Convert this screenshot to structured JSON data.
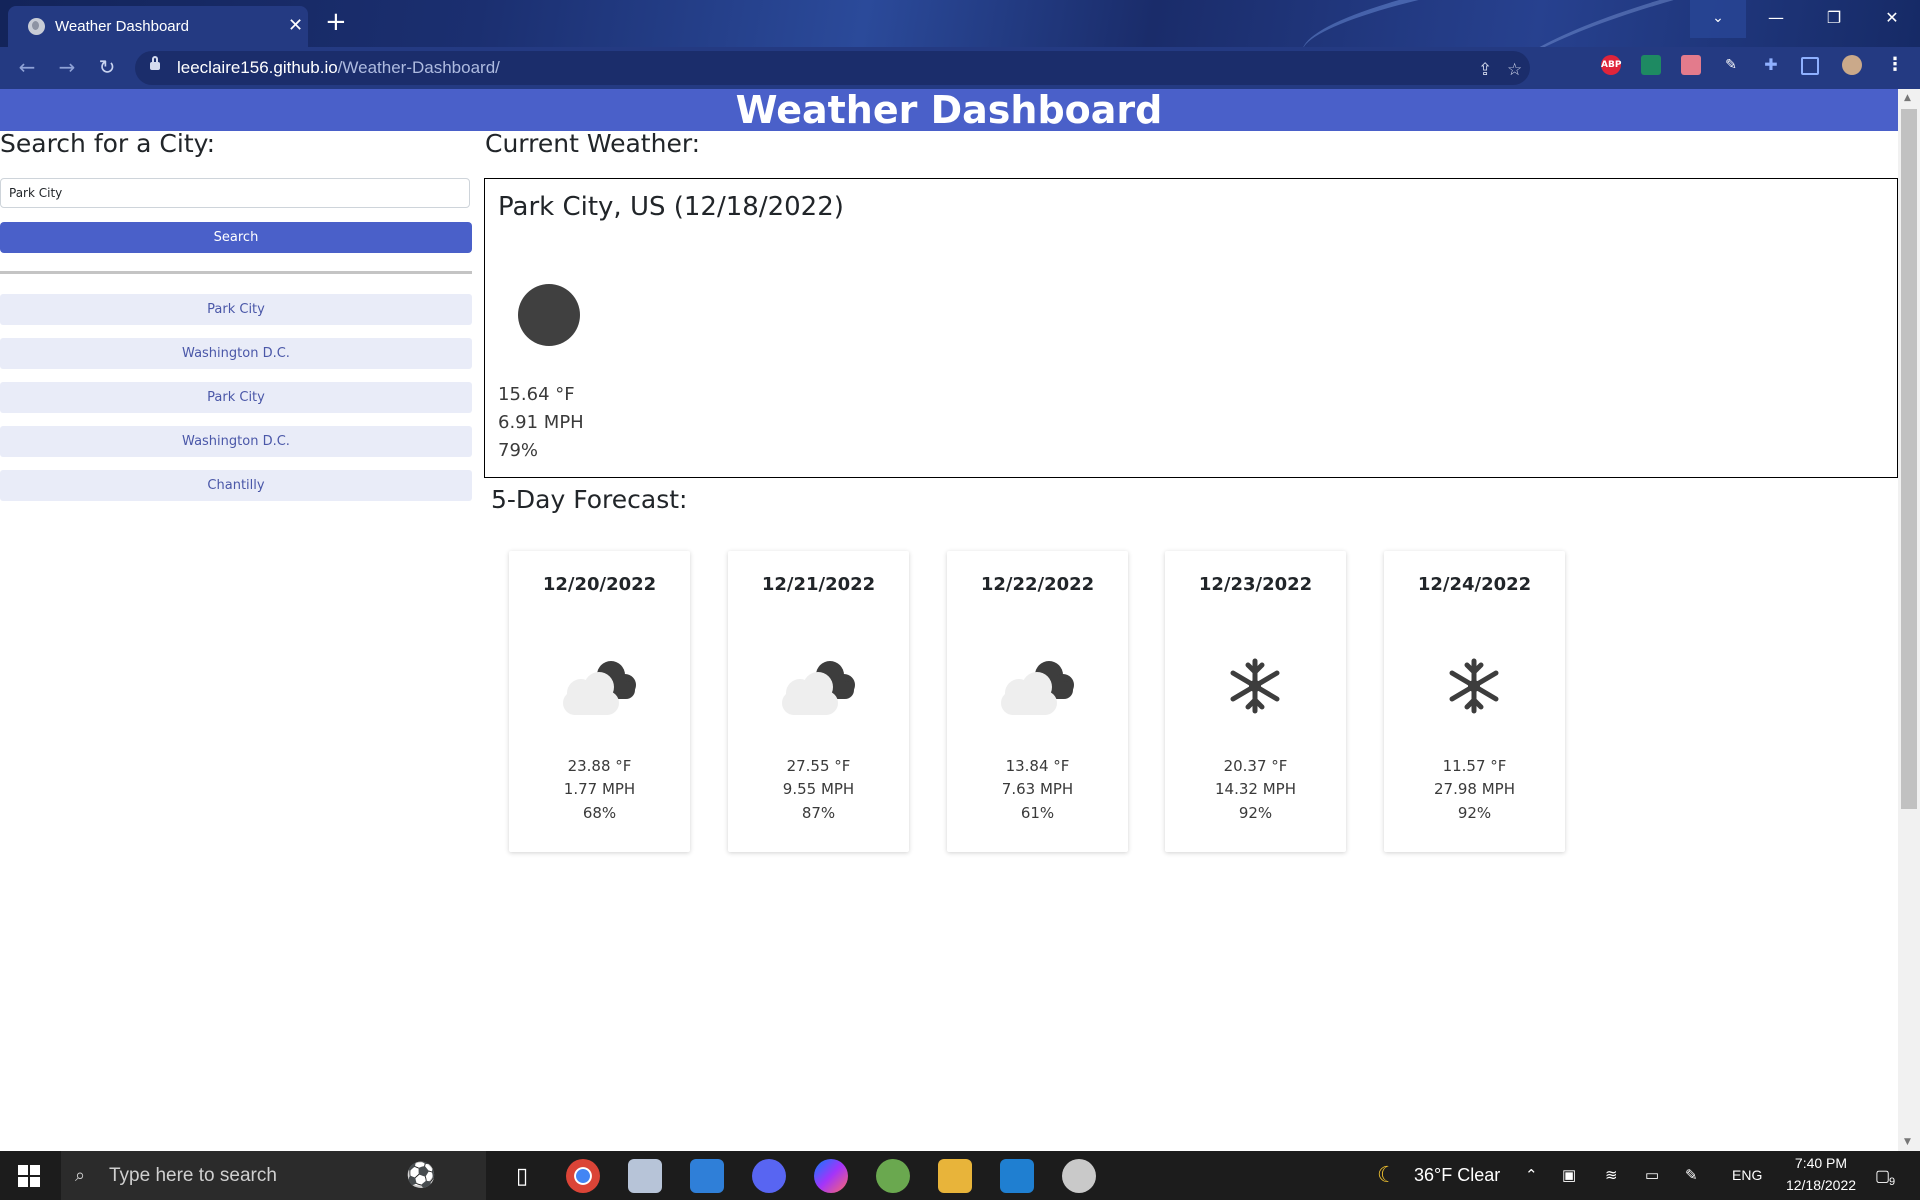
{
  "browser": {
    "tab_title": "Weather Dashboard",
    "tab_close": "✕",
    "new_tab": "+",
    "url_host": "leeclaire156.github.io",
    "url_path": "/Weather-Dashboard/",
    "window_controls": {
      "tab_search": "⌄",
      "minimize": "—",
      "restore": "❐",
      "close": "✕"
    },
    "nav": {
      "back": "←",
      "forward": "→",
      "reload": "↻"
    },
    "extensions": [
      "ABP"
    ]
  },
  "page": {
    "title": "Weather Dashboard",
    "search": {
      "heading": "Search for a City:",
      "input_value": "Park City",
      "button_label": "Search"
    },
    "history": [
      "Park City",
      "Washington D.C.",
      "Park City",
      "Washington D.C.",
      "Chantilly"
    ],
    "current": {
      "heading": "Current Weather:",
      "city_date": "Park City, US (12/18/2022)",
      "icon": "moon-icon",
      "temp": "15.64 °F",
      "wind": "6.91 MPH",
      "humidity": "79%"
    },
    "forecast": {
      "heading": "5-Day Forecast:",
      "days": [
        {
          "date": "12/20/2022",
          "icon": "cloudy-night-icon",
          "temp": "23.88 °F",
          "wind": "1.77 MPH",
          "humidity": "68%"
        },
        {
          "date": "12/21/2022",
          "icon": "cloudy-night-icon",
          "temp": "27.55 °F",
          "wind": "9.55 MPH",
          "humidity": "87%"
        },
        {
          "date": "12/22/2022",
          "icon": "cloudy-night-icon",
          "temp": "13.84 °F",
          "wind": "7.63 MPH",
          "humidity": "61%"
        },
        {
          "date": "12/23/2022",
          "icon": "snowflake-icon",
          "temp": "20.37 °F",
          "wind": "14.32 MPH",
          "humidity": "92%"
        },
        {
          "date": "12/24/2022",
          "icon": "snowflake-icon",
          "temp": "11.57 °F",
          "wind": "27.98 MPH",
          "humidity": "92%"
        }
      ]
    }
  },
  "taskbar": {
    "search_placeholder": "Type here to search",
    "weather": "36°F  Clear",
    "language": "ENG",
    "time": "7:40 PM",
    "date": "12/18/2022",
    "notifications": "9"
  },
  "colors": {
    "accent": "#4a60c9",
    "history_bg": "#e9ecf8",
    "history_text": "#4a57a8",
    "browser_frame": "#243a82"
  }
}
